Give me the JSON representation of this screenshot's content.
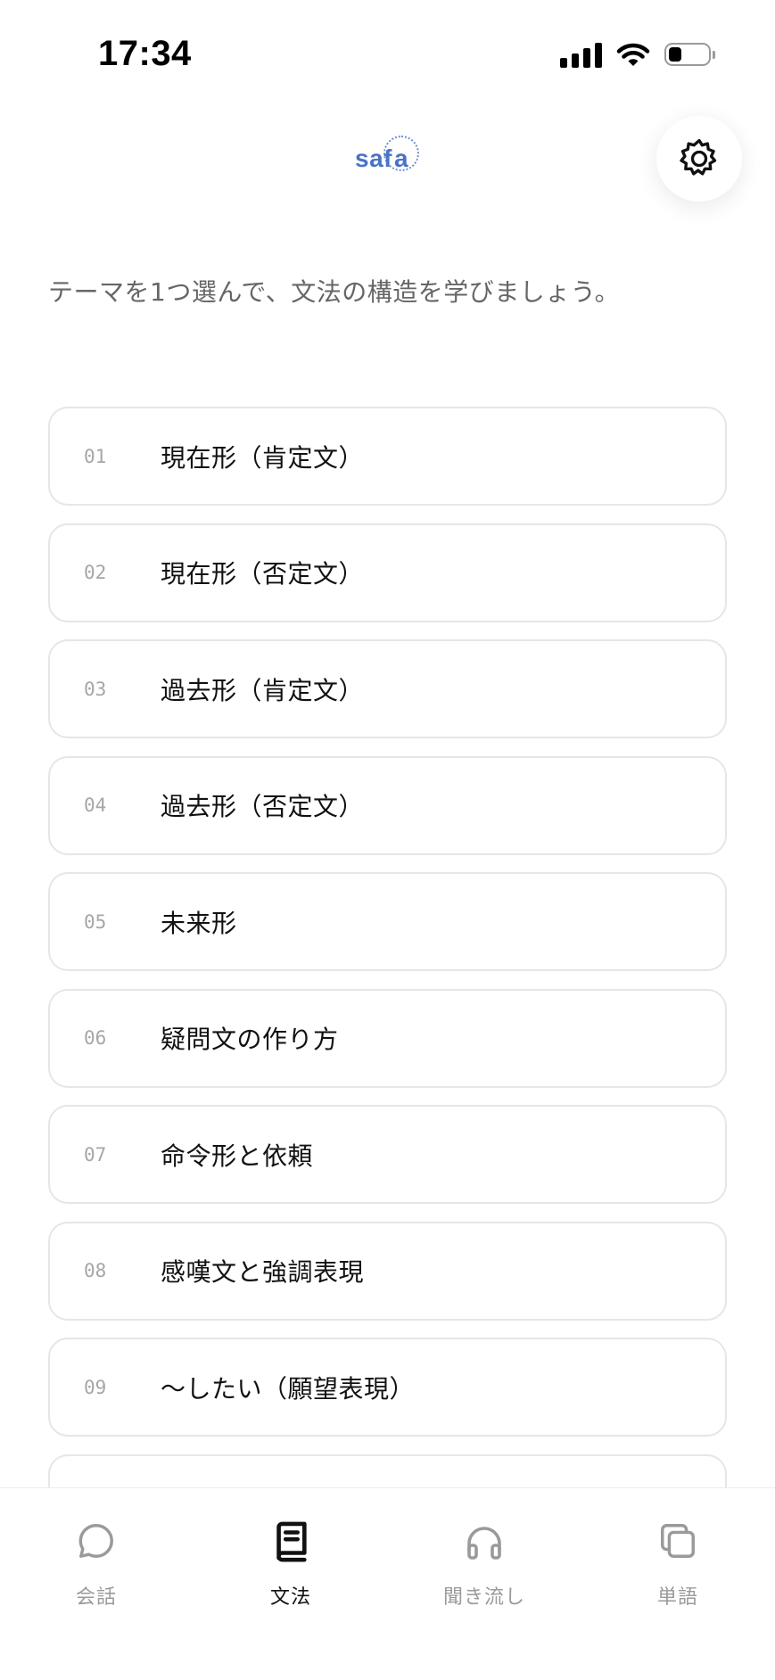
{
  "status_bar": {
    "time": "17:34",
    "battery_level": 0.3
  },
  "header": {
    "logo_text": "saf",
    "logo_accent_letter": "a",
    "settings_icon": "gear-icon"
  },
  "intro_text": "テーマを1つ選んで、文法の構造を学びましょう。",
  "topics": [
    {
      "num": "01",
      "title": "現在形（肯定文）"
    },
    {
      "num": "02",
      "title": "現在形（否定文）"
    },
    {
      "num": "03",
      "title": "過去形（肯定文）"
    },
    {
      "num": "04",
      "title": "過去形（否定文）"
    },
    {
      "num": "05",
      "title": "未来形"
    },
    {
      "num": "06",
      "title": "疑問文の作り方"
    },
    {
      "num": "07",
      "title": "命令形と依頼"
    },
    {
      "num": "08",
      "title": "感嘆文と強調表現"
    },
    {
      "num": "09",
      "title": "〜したい（願望表現）"
    }
  ],
  "tabs": [
    {
      "label": "会話",
      "icon": "speech-bubble-icon",
      "active": false
    },
    {
      "label": "文法",
      "icon": "book-icon",
      "active": true
    },
    {
      "label": "聞き流し",
      "icon": "headphones-icon",
      "active": false
    },
    {
      "label": "単語",
      "icon": "cards-icon",
      "active": false
    }
  ],
  "colors": {
    "brand": "#4a72c6",
    "inactive_tab": "#9a9a9a",
    "active_tab": "#111111",
    "card_border": "#e6e6e6"
  }
}
